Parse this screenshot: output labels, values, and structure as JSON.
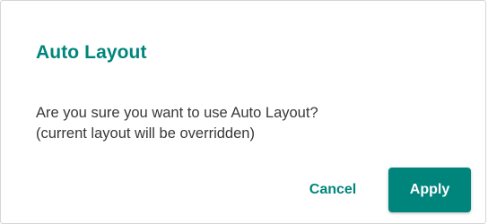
{
  "dialog": {
    "title": "Auto Layout",
    "message_line1": "Are you sure you want to use Auto Layout?",
    "message_line2": "(current layout will be overridden)",
    "cancel_label": "Cancel",
    "apply_label": "Apply"
  },
  "colors": {
    "accent": "#00857c",
    "text": "#383838",
    "border": "#d6d6d6",
    "background": "#ffffff"
  }
}
